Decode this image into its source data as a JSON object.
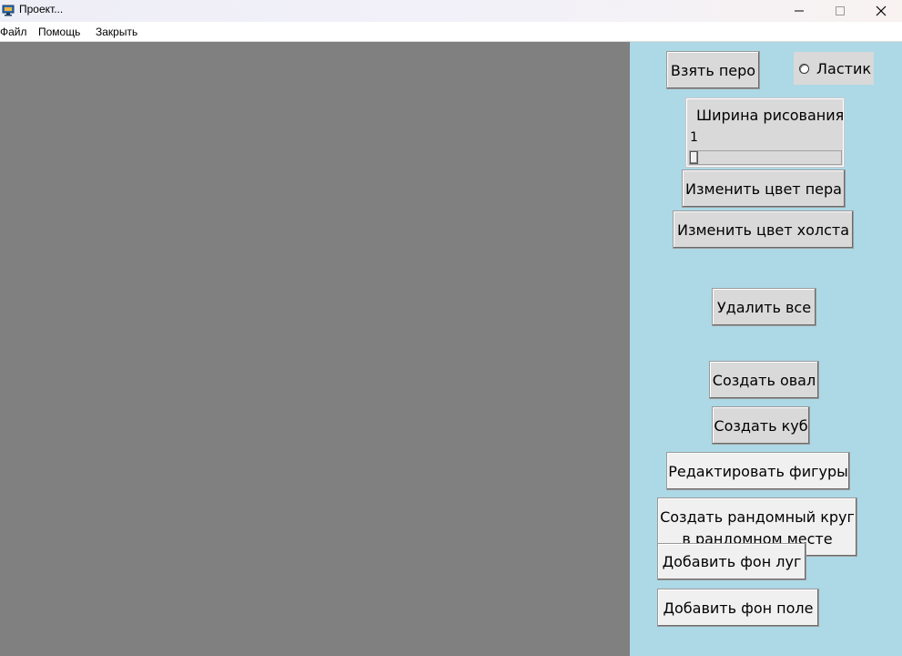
{
  "window": {
    "title": "Проект...",
    "minimize_symbol": "—",
    "maximize_symbol": "☐",
    "close_symbol": "✕"
  },
  "menu": {
    "items": [
      "Файл",
      "Помощь",
      "Закрыть"
    ]
  },
  "colors": {
    "canvas": "#808080",
    "panel": "#add8e6",
    "button": "#d9d9d9",
    "button_light": "#f0f0f0"
  },
  "tools": {
    "take_pen": "Взять перо",
    "eraser": "Ластик",
    "eraser_checked": false
  },
  "width_scale": {
    "label": "Ширина рисования",
    "value": "1",
    "min": 1,
    "max": 100
  },
  "buttons": {
    "change_pen_color": "Изменить цвет пера",
    "change_canvas_color": "Изменить цвет холста",
    "delete_all": "Удалить все",
    "create_oval": "Создать овал",
    "create_cube": "Создать куб",
    "edit_shapes": "Редактировать фигуры",
    "random_circle_line1": "Создать рандомный круг",
    "random_circle_line2": "в рандомном месте",
    "add_meadow_bg": "Добавить фон луг",
    "add_field_bg": "Добавить фон поле"
  }
}
